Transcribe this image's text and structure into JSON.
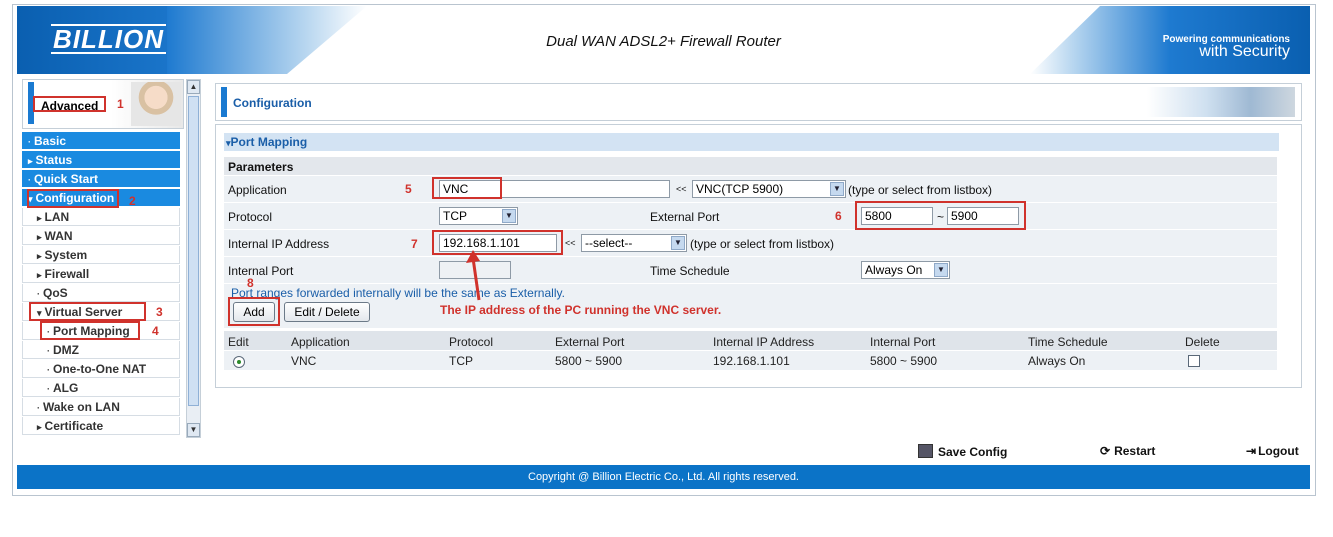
{
  "header": {
    "logo": "BILLION",
    "product_title": "Dual WAN ADSL2+ Firewall Router",
    "powering_line1": "Powering communications",
    "powering_line2": "with Security"
  },
  "sidebar": {
    "mode_label": "Advanced",
    "items": [
      {
        "label": "Basic",
        "arrow": "·"
      },
      {
        "label": "Status",
        "arrow": "▸"
      },
      {
        "label": "Quick Start",
        "arrow": "·"
      },
      {
        "label": "Configuration",
        "arrow": "▾"
      },
      {
        "label": "LAN",
        "arrow": "▸"
      },
      {
        "label": "WAN",
        "arrow": "▸"
      },
      {
        "label": "System",
        "arrow": "▸"
      },
      {
        "label": "Firewall",
        "arrow": "▸"
      },
      {
        "label": "QoS",
        "arrow": "·"
      },
      {
        "label": "Virtual Server",
        "arrow": "▾"
      },
      {
        "label": "Port Mapping",
        "arrow": "·"
      },
      {
        "label": "DMZ",
        "arrow": "·"
      },
      {
        "label": "One-to-One NAT",
        "arrow": "·"
      },
      {
        "label": "ALG",
        "arrow": "·"
      },
      {
        "label": "Wake on LAN",
        "arrow": "·"
      },
      {
        "label": "Certificate",
        "arrow": "▸"
      }
    ]
  },
  "main": {
    "section_title": "Configuration",
    "panel_title": "Port Mapping",
    "params_label": "Parameters",
    "application_label": "Application",
    "application_value": "VNC",
    "application_select": "VNC(TCP 5900)",
    "application_hint": "(type or select from listbox)",
    "protocol_label": "Protocol",
    "protocol_value": "TCP",
    "external_port_label": "External Port",
    "external_port_from": "5800",
    "external_port_sep": "~",
    "external_port_to": "5900",
    "internal_ip_label": "Internal IP Address",
    "internal_ip_value": "192.168.1.101",
    "internal_ip_select": "--select--",
    "internal_ip_hint": "(type or select from listbox)",
    "internal_port_label": "Internal Port",
    "internal_port_value": "",
    "time_schedule_label": "Time Schedule",
    "time_schedule_value": "Always On",
    "note": "Port ranges forwarded internally will be the same as Externally.",
    "add_button": "Add",
    "edit_delete_button": "Edit / Delete",
    "selector_arrows": "<<",
    "annotation": "The IP address of the PC running the VNC server.",
    "table": {
      "headers": [
        "Edit",
        "Application",
        "Protocol",
        "External Port",
        "Internal IP Address",
        "Internal Port",
        "Time Schedule",
        "Delete"
      ],
      "row": {
        "application": "VNC",
        "protocol": "TCP",
        "external_port": "5800 ~ 5900",
        "internal_ip": "192.168.1.101",
        "internal_port": "5800 ~ 5900",
        "time_schedule": "Always On"
      }
    }
  },
  "markers": [
    "1",
    "2",
    "3",
    "4",
    "5",
    "6",
    "7",
    "8"
  ],
  "toolbar": {
    "save": "Save Config",
    "restart": "Restart",
    "logout": "Logout"
  },
  "footer": {
    "copyright": "Copyright @ Billion Electric Co., Ltd. All rights reserved."
  },
  "colors": {
    "accent": "#1a8ae0",
    "annotation": "#d0322c",
    "footer": "#0b73c7"
  }
}
